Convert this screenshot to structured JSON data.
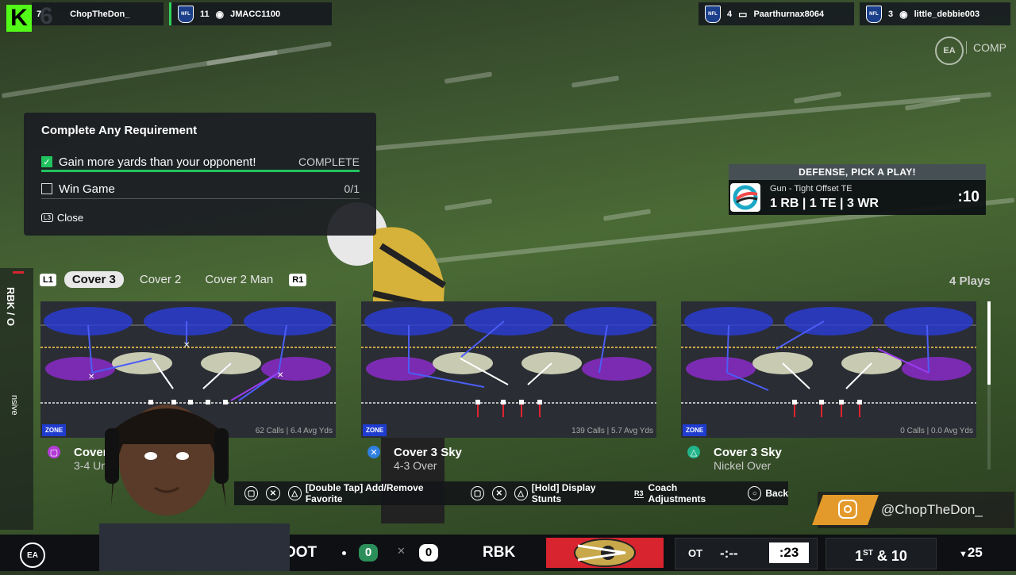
{
  "overlay": {
    "k_label": "K",
    "k_score": "6"
  },
  "players": [
    {
      "num": "7",
      "name": "ChopTheDon_"
    },
    {
      "shield": "NFL",
      "num": "11",
      "name": "JMACC1100"
    },
    {
      "shield": "NFL",
      "num": "4",
      "name": "Paarthurnax8064"
    },
    {
      "shield": "NFL",
      "num": "3",
      "name": "little_debbie003"
    }
  ],
  "brand": {
    "ea": "EA",
    "comp": "COMP"
  },
  "requirements": {
    "title": "Complete Any Requirement",
    "items": [
      {
        "label": "Gain more yards than your opponent!",
        "status": "COMPLETE",
        "checked": true,
        "progress": 1.0
      },
      {
        "label": "Win Game",
        "status": "0/1",
        "checked": false,
        "progress": 0.0
      }
    ],
    "close_glyph": "L3",
    "close_label": "Close"
  },
  "defense": {
    "header": "DEFENSE, PICK A PLAY!",
    "formation": "Gun - Tight Offset TE",
    "personnel": "1 RB | 1 TE | 3 WR",
    "clock": ":10"
  },
  "tabs": {
    "left_button": "L1",
    "right_button": "R1",
    "items": [
      "Cover 3",
      "Cover 2",
      "Cover 2 Man"
    ],
    "selected": "Cover 3",
    "plays_count": "4 Plays"
  },
  "side_label": "RBK / O",
  "side_label2": "nsive",
  "plays": [
    {
      "zone": "ZONE",
      "stats": "62 Calls | 6.4 Avg Yds",
      "name": "Cover 3",
      "formation": "3-4 Und",
      "button": "square",
      "button_color": "#b23bd6"
    },
    {
      "zone": "ZONE",
      "stats": "139 Calls | 5.7 Avg Yds",
      "name": "Cover 3 Sky",
      "formation": "4-3 Over",
      "button": "cross",
      "button_color": "#2f7fe0"
    },
    {
      "zone": "ZONE",
      "stats": "0 Calls | 0.0 Avg Yds",
      "name": "Cover 3 Sky",
      "formation": "Nickel Over",
      "button": "triangle",
      "button_color": "#22b48a"
    }
  ],
  "controls": {
    "favorite": "[Double Tap] Add/Remove Favorite",
    "stunts": "[Hold] Display Stunts",
    "r3": "R3",
    "coach": "Coach Adjustments",
    "back": "Back"
  },
  "social": {
    "handle": "@ChopTheDon_"
  },
  "scoreboard": {
    "ea": "EA",
    "away_abbr": "OOT",
    "away_score": "0",
    "home_abbr": "RBK",
    "home_score": "0",
    "quarter": "OT",
    "game_clock": "-:--",
    "play_clock": ":23",
    "down": "1",
    "down_suffix": "ST",
    "distance": "& 10",
    "yardline": "25",
    "colors": {
      "home": "#d8242f",
      "accent": "#c8a84a"
    }
  }
}
